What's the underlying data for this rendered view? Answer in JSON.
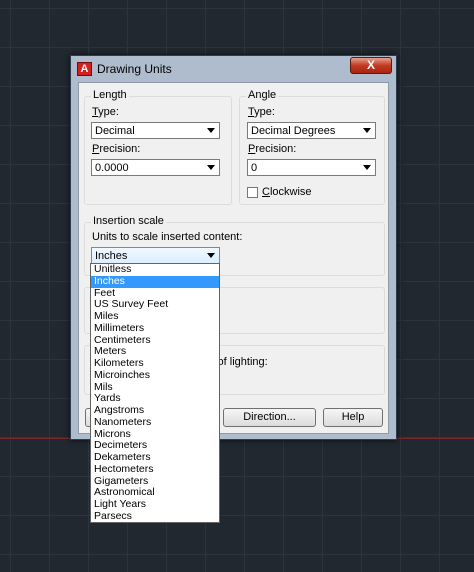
{
  "dialog": {
    "title": "Drawing Units",
    "close_label": "X",
    "app_icon_letter": "A"
  },
  "length": {
    "group_label": "Length",
    "type_label": "Type:",
    "type_value": "Decimal",
    "precision_label": "Precision:",
    "precision_value": "0.0000"
  },
  "angle": {
    "group_label": "Angle",
    "type_label": "Type:",
    "type_value": "Decimal Degrees",
    "precision_label": "Precision:",
    "precision_value": "0",
    "clockwise_label": "Clockwise",
    "clockwise_checked": false
  },
  "insertion": {
    "group_label": "Insertion scale",
    "units_label": "Units to scale inserted content:",
    "units_value": "Inches",
    "units_options": [
      "Unitless",
      "Inches",
      "Feet",
      "US Survey Feet",
      "Miles",
      "Millimeters",
      "Centimeters",
      "Meters",
      "Kilometers",
      "Microinches",
      "Mils",
      "Yards",
      "Angstroms",
      "Nanometers",
      "Microns",
      "Decimeters",
      "Dekameters",
      "Hectometers",
      "Gigameters",
      "Astronomical",
      "Light Years",
      "Parsecs"
    ],
    "selected_index": 1
  },
  "lighting_fragment": "y of lighting:",
  "buttons": {
    "direction": "Direction...",
    "help": "Help"
  }
}
